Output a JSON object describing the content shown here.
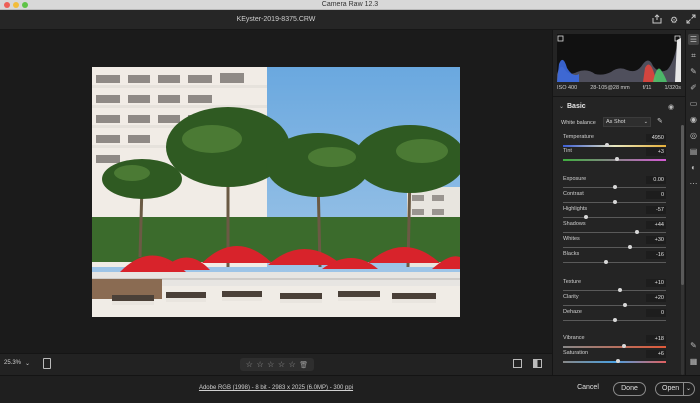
{
  "window": {
    "title": "Camera Raw 12.3"
  },
  "file": {
    "name": "KEyster-2019-8375.CRW"
  },
  "histogram_meta": {
    "iso": "ISO 400",
    "lens": "28-105@28 mm",
    "aperture": "f/11",
    "shutter": "1/320s"
  },
  "basic": {
    "title": "Basic",
    "white_balance": {
      "label": "White balance",
      "value": "As Shot"
    },
    "sliders": [
      {
        "label": "Temperature",
        "value": "4950",
        "pos": 0.43
      },
      {
        "label": "Tint",
        "value": "+3",
        "pos": 0.52
      },
      {
        "label": "Exposure",
        "value": "0.00",
        "pos": 0.5
      },
      {
        "label": "Contrast",
        "value": "0",
        "pos": 0.5
      },
      {
        "label": "Highlights",
        "value": "-57",
        "pos": 0.22
      },
      {
        "label": "Shadows",
        "value": "+44",
        "pos": 0.72
      },
      {
        "label": "Whites",
        "value": "+30",
        "pos": 0.65
      },
      {
        "label": "Blacks",
        "value": "-16",
        "pos": 0.42
      },
      {
        "label": "Texture",
        "value": "+10",
        "pos": 0.55
      },
      {
        "label": "Clarity",
        "value": "+20",
        "pos": 0.6
      },
      {
        "label": "Dehaze",
        "value": "0",
        "pos": 0.5
      },
      {
        "label": "Vibrance",
        "value": "+18",
        "pos": 0.59
      },
      {
        "label": "Saturation",
        "value": "+6",
        "pos": 0.53
      }
    ]
  },
  "canvas": {
    "zoom": "25.3%"
  },
  "footer": {
    "workflow": "Adobe RGB (1998) - 8 bit - 2983 x 2025 (6.0MP) - 300 ppi",
    "cancel": "Cancel",
    "done": "Done",
    "open": "Open"
  },
  "icons": {
    "share": "share-icon",
    "settings": "gear-icon",
    "fullscreen": "expand-icon"
  }
}
